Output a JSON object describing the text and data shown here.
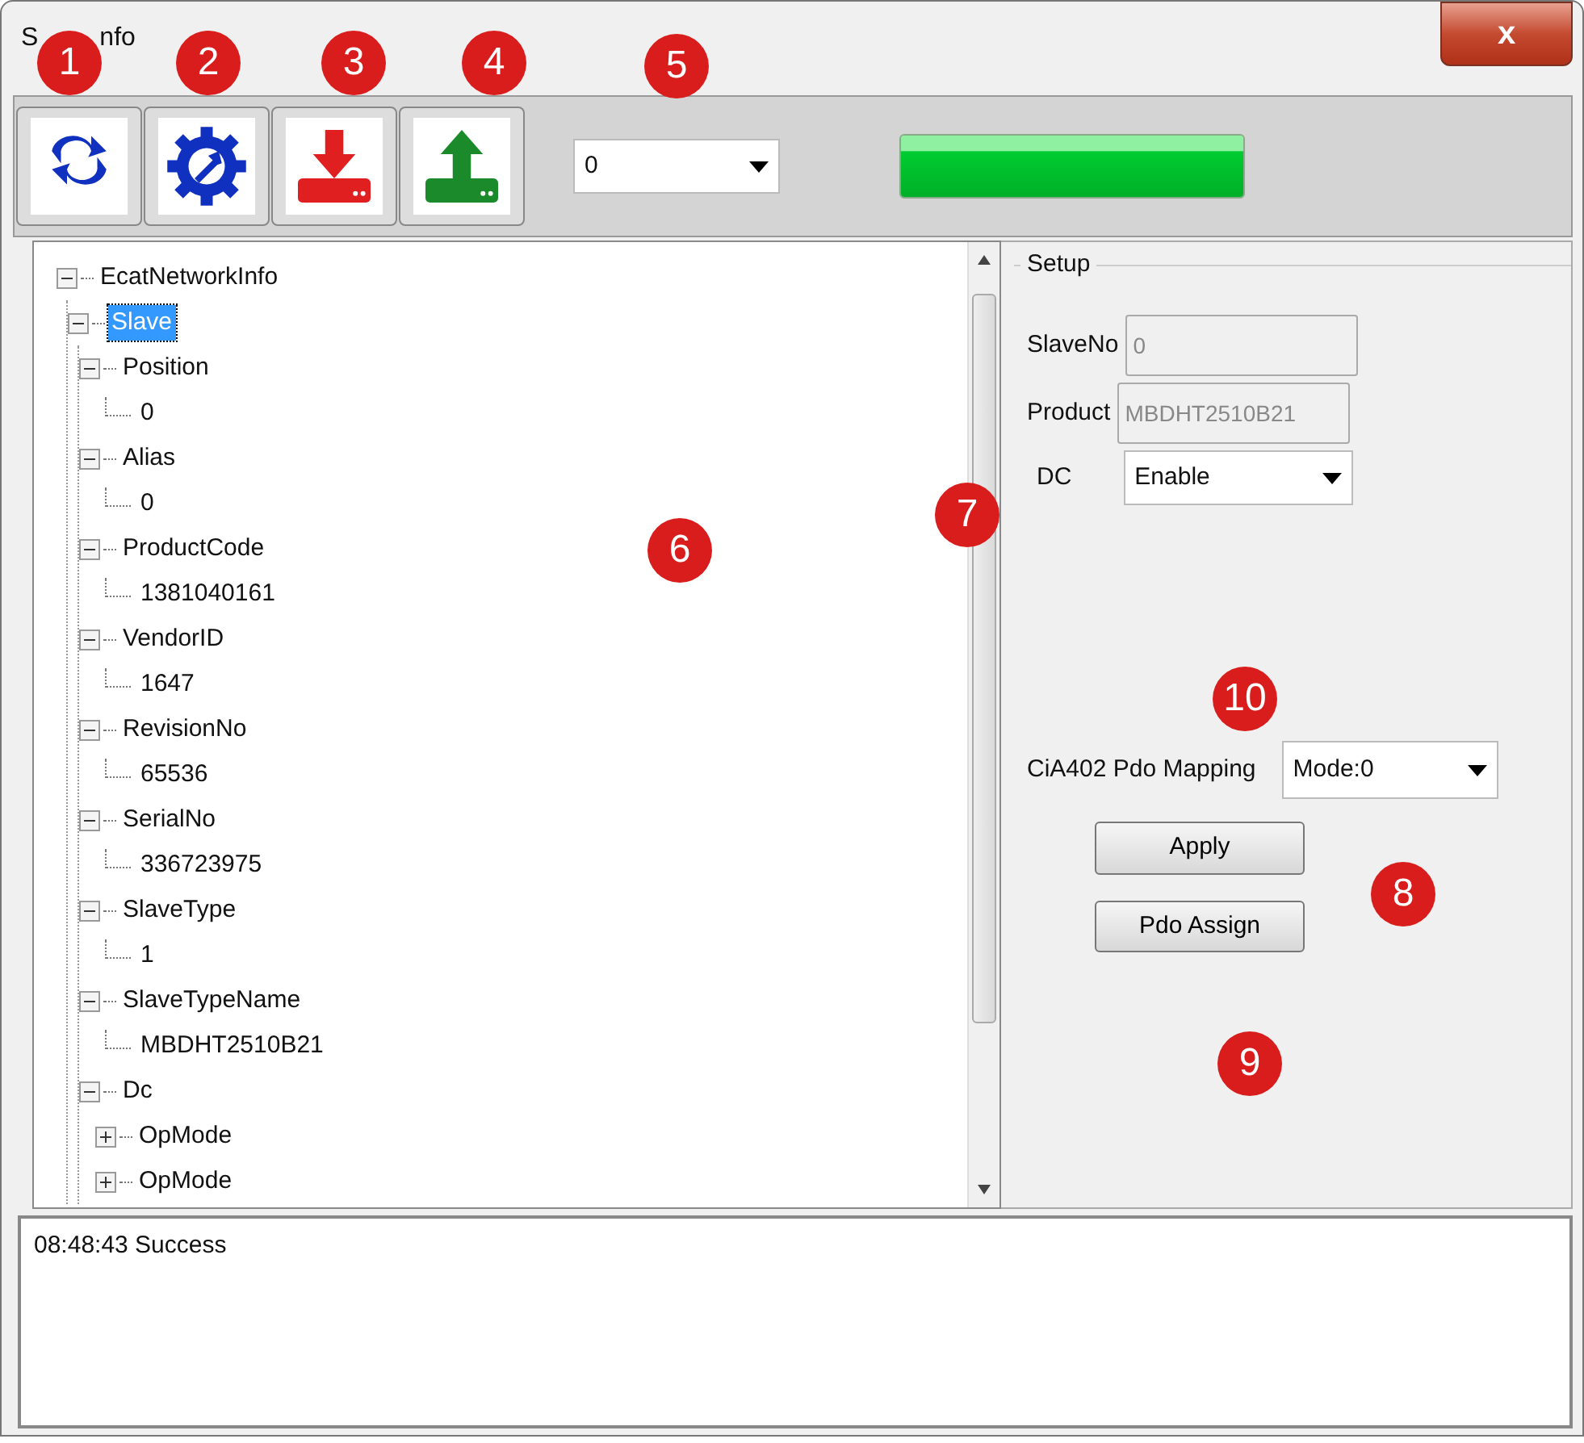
{
  "window": {
    "title_fragments": [
      "S",
      "nfo"
    ],
    "close_label": "x"
  },
  "toolbar": {
    "buttons": [
      {
        "kind": "refresh",
        "badge": "1"
      },
      {
        "kind": "config",
        "badge": "2"
      },
      {
        "kind": "download",
        "badge": "3"
      },
      {
        "kind": "upload",
        "badge": "4"
      }
    ],
    "slave_select": {
      "value": "0",
      "badge": "5"
    },
    "progress": {
      "level": 1.0
    }
  },
  "tree": {
    "badge": "6",
    "items": [
      {
        "label": "EcatNetworkInfo",
        "expanded": true,
        "selected": false,
        "children": [
          {
            "label": "Slave",
            "expanded": true,
            "selected": true,
            "children": [
              {
                "label": "Position",
                "expanded": true,
                "selected": false,
                "children": [
                  {
                    "label": "0",
                    "selected": false
                  }
                ]
              },
              {
                "label": "Alias",
                "expanded": true,
                "selected": false,
                "children": [
                  {
                    "label": "0",
                    "selected": false
                  }
                ]
              },
              {
                "label": "ProductCode",
                "expanded": true,
                "selected": false,
                "children": [
                  {
                    "label": "1381040161",
                    "selected": false
                  }
                ]
              },
              {
                "label": "VendorID",
                "expanded": true,
                "selected": false,
                "children": [
                  {
                    "label": "1647",
                    "selected": false
                  }
                ]
              },
              {
                "label": "RevisionNo",
                "expanded": true,
                "selected": false,
                "children": [
                  {
                    "label": "65536",
                    "selected": false
                  }
                ]
              },
              {
                "label": "SerialNo",
                "expanded": true,
                "selected": false,
                "children": [
                  {
                    "label": "336723975",
                    "selected": false
                  }
                ]
              },
              {
                "label": "SlaveType",
                "expanded": true,
                "selected": false,
                "children": [
                  {
                    "label": "1",
                    "selected": false
                  }
                ]
              },
              {
                "label": "SlaveTypeName",
                "expanded": true,
                "selected": false,
                "children": [
                  {
                    "label": "MBDHT2510B21",
                    "selected": false
                  }
                ]
              },
              {
                "label": "Dc",
                "expanded": true,
                "selected": false,
                "children": [
                  {
                    "label": "OpMode",
                    "expanded": false,
                    "selected": false
                  },
                  {
                    "label": "OpMode",
                    "expanded": false,
                    "selected": false
                  }
                ]
              }
            ]
          }
        ]
      }
    ]
  },
  "setup": {
    "title": "Setup",
    "fields": [
      {
        "kind": "text",
        "label": "SlaveNo",
        "value": "0",
        "disabled": true
      },
      {
        "kind": "text",
        "label": "Product",
        "value": "MBDHT2510B21",
        "disabled": true
      },
      {
        "kind": "select",
        "label": "DC",
        "value": "Enable",
        "disabled": false,
        "badge": "7"
      }
    ],
    "badge_above_mapping": "10",
    "mapping": {
      "label": "CiA402 Pdo Mapping",
      "value": "Mode:0",
      "badge": "8"
    },
    "buttons": [
      {
        "label": "Apply"
      },
      {
        "label": "Pdo Assign",
        "badge": "9"
      }
    ]
  },
  "log": {
    "lines": [
      "08:48:43 Success"
    ]
  }
}
